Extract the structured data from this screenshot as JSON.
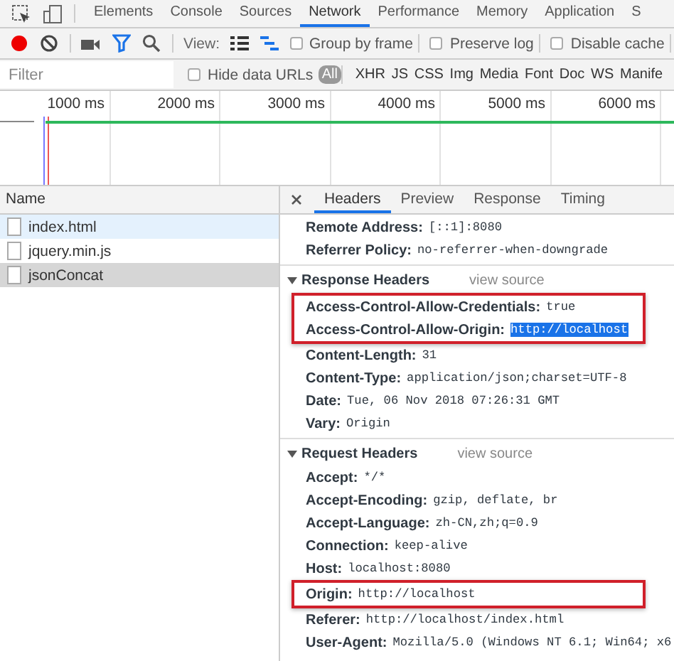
{
  "main_tabs": [
    {
      "label": "Elements",
      "selected": false
    },
    {
      "label": "Console",
      "selected": false
    },
    {
      "label": "Sources",
      "selected": false
    },
    {
      "label": "Network",
      "selected": true
    },
    {
      "label": "Performance",
      "selected": false
    },
    {
      "label": "Memory",
      "selected": false
    },
    {
      "label": "Application",
      "selected": false
    },
    {
      "label": "S",
      "selected": false
    }
  ],
  "toolbar": {
    "recording": true,
    "filter_active": true,
    "view_label": "View:",
    "options": [
      {
        "label": "Group by frame",
        "checked": false
      },
      {
        "label": "Preserve log",
        "checked": false
      },
      {
        "label": "Disable cache",
        "checked": false
      }
    ]
  },
  "filter_bar": {
    "placeholder": "Filter",
    "hide_data_urls": {
      "label": "Hide data URLs",
      "checked": false
    },
    "types": [
      {
        "label": "All",
        "selected": true
      },
      {
        "label": "XHR",
        "selected": false
      },
      {
        "label": "JS",
        "selected": false
      },
      {
        "label": "CSS",
        "selected": false
      },
      {
        "label": "Img",
        "selected": false
      },
      {
        "label": "Media",
        "selected": false
      },
      {
        "label": "Font",
        "selected": false
      },
      {
        "label": "Doc",
        "selected": false
      },
      {
        "label": "WS",
        "selected": false
      },
      {
        "label": "Manife",
        "selected": false
      }
    ]
  },
  "timeline": {
    "ticks": [
      "1000 ms",
      "2000 ms",
      "3000 ms",
      "4000 ms",
      "5000 ms",
      "6000 ms"
    ]
  },
  "requests": {
    "column": "Name",
    "rows": [
      {
        "name": "index.html",
        "selected": false,
        "hovered": true
      },
      {
        "name": "jquery.min.js",
        "selected": false,
        "hovered": false
      },
      {
        "name": "jsonConcat",
        "selected": true,
        "hovered": false
      }
    ]
  },
  "detail_tabs": [
    {
      "label": "Headers",
      "selected": true
    },
    {
      "label": "Preview",
      "selected": false
    },
    {
      "label": "Response",
      "selected": false
    },
    {
      "label": "Timing",
      "selected": false
    }
  ],
  "general_rows": [
    {
      "name": "Remote Address:",
      "value": "[::1]:8080",
      "highlighted": false,
      "value_selected": false
    },
    {
      "name": "Referrer Policy:",
      "value": "no-referrer-when-downgrade",
      "highlighted": false,
      "value_selected": false
    }
  ],
  "sections": [
    {
      "title": "Response Headers",
      "expanded": true,
      "link": "view source",
      "rows": [
        {
          "name": "Access-Control-Allow-Credentials:",
          "value": "true",
          "highlighted": true,
          "value_selected": false
        },
        {
          "name": "Access-Control-Allow-Origin:",
          "value": "http://localhost",
          "highlighted": true,
          "value_selected": true
        },
        {
          "name": "Content-Length:",
          "value": "31",
          "highlighted": false,
          "value_selected": false
        },
        {
          "name": "Content-Type:",
          "value": "application/json;charset=UTF-8",
          "highlighted": false,
          "value_selected": false
        },
        {
          "name": "Date:",
          "value": "Tue, 06 Nov 2018 07:26:31 GMT",
          "highlighted": false,
          "value_selected": false
        },
        {
          "name": "Vary:",
          "value": "Origin",
          "highlighted": false,
          "value_selected": false
        }
      ]
    },
    {
      "title": "Request Headers",
      "expanded": true,
      "link": "view source",
      "rows": [
        {
          "name": "Accept:",
          "value": "*/*",
          "highlighted": false,
          "value_selected": false
        },
        {
          "name": "Accept-Encoding:",
          "value": "gzip, deflate, br",
          "highlighted": false,
          "value_selected": false
        },
        {
          "name": "Accept-Language:",
          "value": "zh-CN,zh;q=0.9",
          "highlighted": false,
          "value_selected": false
        },
        {
          "name": "Connection:",
          "value": "keep-alive",
          "highlighted": false,
          "value_selected": false
        },
        {
          "name": "Host:",
          "value": "localhost:8080",
          "highlighted": false,
          "value_selected": false
        },
        {
          "name": "Origin:",
          "value": "http://localhost",
          "highlighted": true,
          "value_selected": false
        },
        {
          "name": "Referer:",
          "value": "http://localhost/index.html",
          "highlighted": false,
          "value_selected": false
        },
        {
          "name": "User-Agent:",
          "value": "Mozilla/5.0 (Windows NT 6.1; Win64; x6",
          "highlighted": false,
          "value_selected": false
        }
      ]
    }
  ]
}
